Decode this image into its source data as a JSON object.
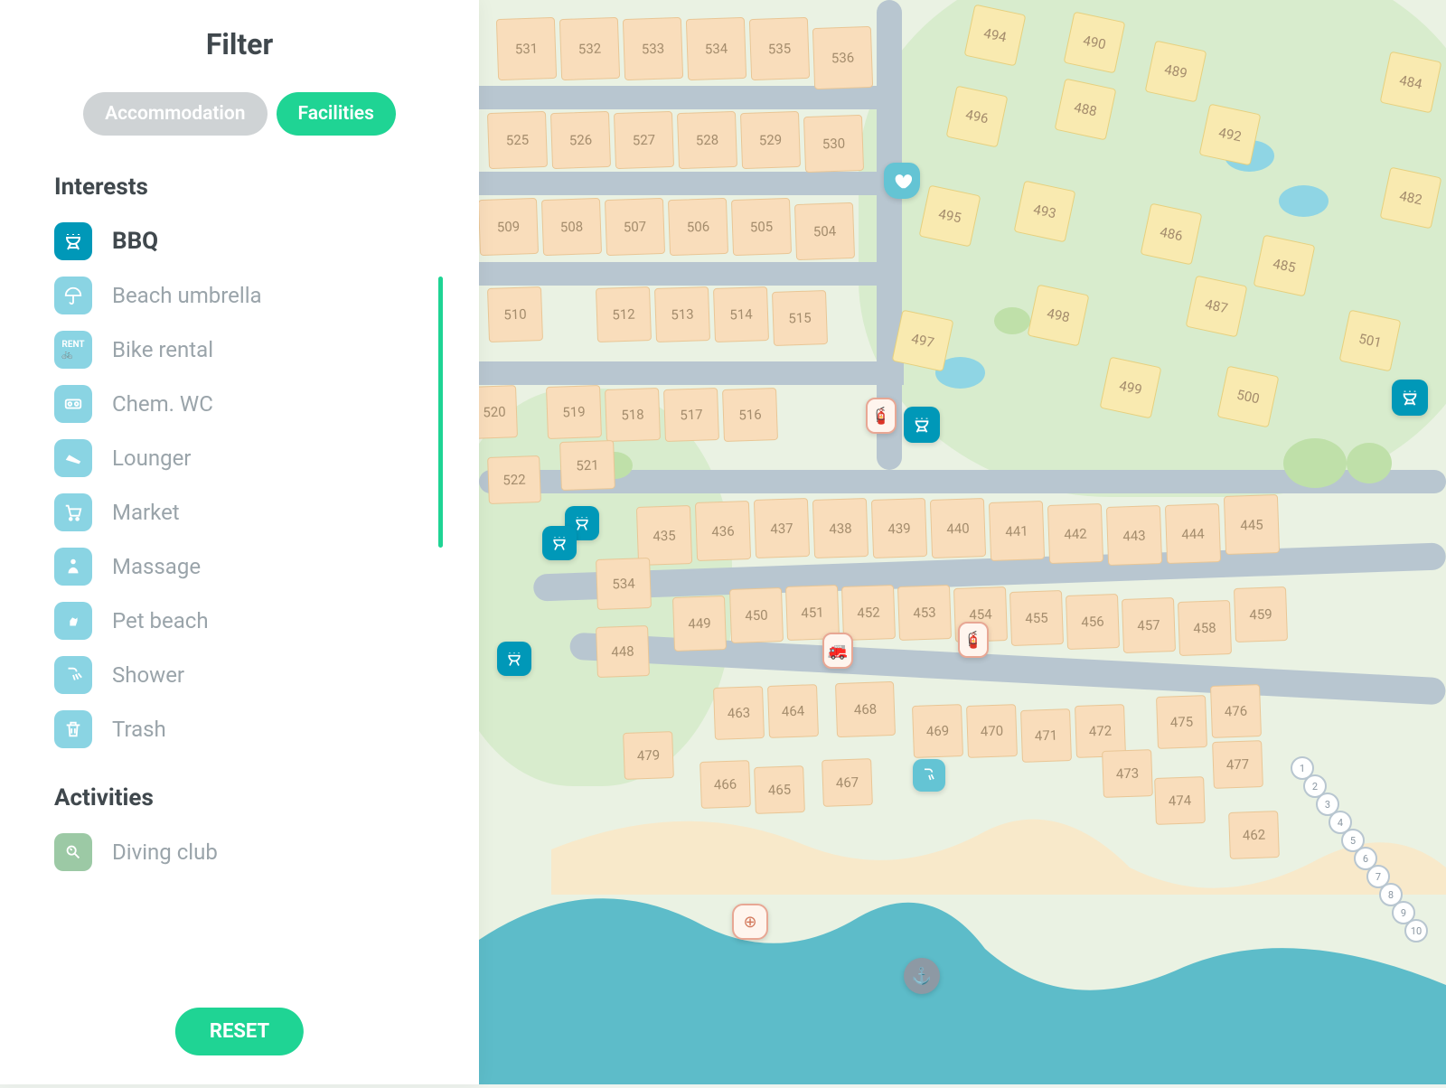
{
  "sidebar": {
    "title": "Filter",
    "tabs": {
      "accommodation": "Accommodation",
      "facilities": "Facilities"
    },
    "section_interests": "Interests",
    "section_activities": "Activities",
    "interests": [
      {
        "label": "BBQ",
        "selected": true
      },
      {
        "label": "Beach umbrella"
      },
      {
        "label": "Bike rental"
      },
      {
        "label": "Chem. WC"
      },
      {
        "label": "Lounger"
      },
      {
        "label": "Market"
      },
      {
        "label": "Massage"
      },
      {
        "label": "Pet beach"
      },
      {
        "label": "Shower"
      },
      {
        "label": "Trash"
      }
    ],
    "activities": [
      {
        "label": "Diving club"
      }
    ],
    "reset_label": "RESET"
  },
  "map": {
    "row1": [
      "531",
      "532",
      "533",
      "534",
      "535",
      "536"
    ],
    "row2": [
      "525",
      "526",
      "527",
      "528",
      "529",
      "530"
    ],
    "row3": [
      "509",
      "508",
      "507",
      "506",
      "505",
      "504"
    ],
    "row4_start": "510",
    "row4": [
      "512",
      "513",
      "514",
      "515"
    ],
    "row5_start": "520",
    "row5": [
      "519",
      "518",
      "517",
      "516"
    ],
    "lot521": "521",
    "lot522": "522",
    "row_mid": [
      "435",
      "436",
      "437",
      "438",
      "439",
      "440",
      "441",
      "442",
      "443",
      "444",
      "445"
    ],
    "lot534": "534",
    "row_lower": [
      "449",
      "450",
      "451",
      "452",
      "453",
      "454",
      "455",
      "456",
      "457",
      "458",
      "459"
    ],
    "lot448": "448",
    "row_bottom1": [
      "463",
      "464",
      "468",
      "469",
      "470",
      "471",
      "472",
      "475",
      "476"
    ],
    "lot479": "479",
    "row_bottom2": [
      "466",
      "465",
      "467"
    ],
    "extras": [
      "473",
      "474",
      "477",
      "462"
    ],
    "yellow_top": [
      "494",
      "490",
      "489",
      "484"
    ],
    "yellow_mid1": [
      "496",
      "488",
      "492"
    ],
    "yellow_mid2": [
      "495",
      "493",
      "486",
      "485",
      "482"
    ],
    "yellow_mid3": [
      "497",
      "498",
      "487",
      "501"
    ],
    "yellow_low": [
      "499",
      "500"
    ],
    "umbrella_nums": [
      "1",
      "2",
      "3",
      "4",
      "5",
      "6",
      "7",
      "8",
      "9",
      "10"
    ]
  }
}
